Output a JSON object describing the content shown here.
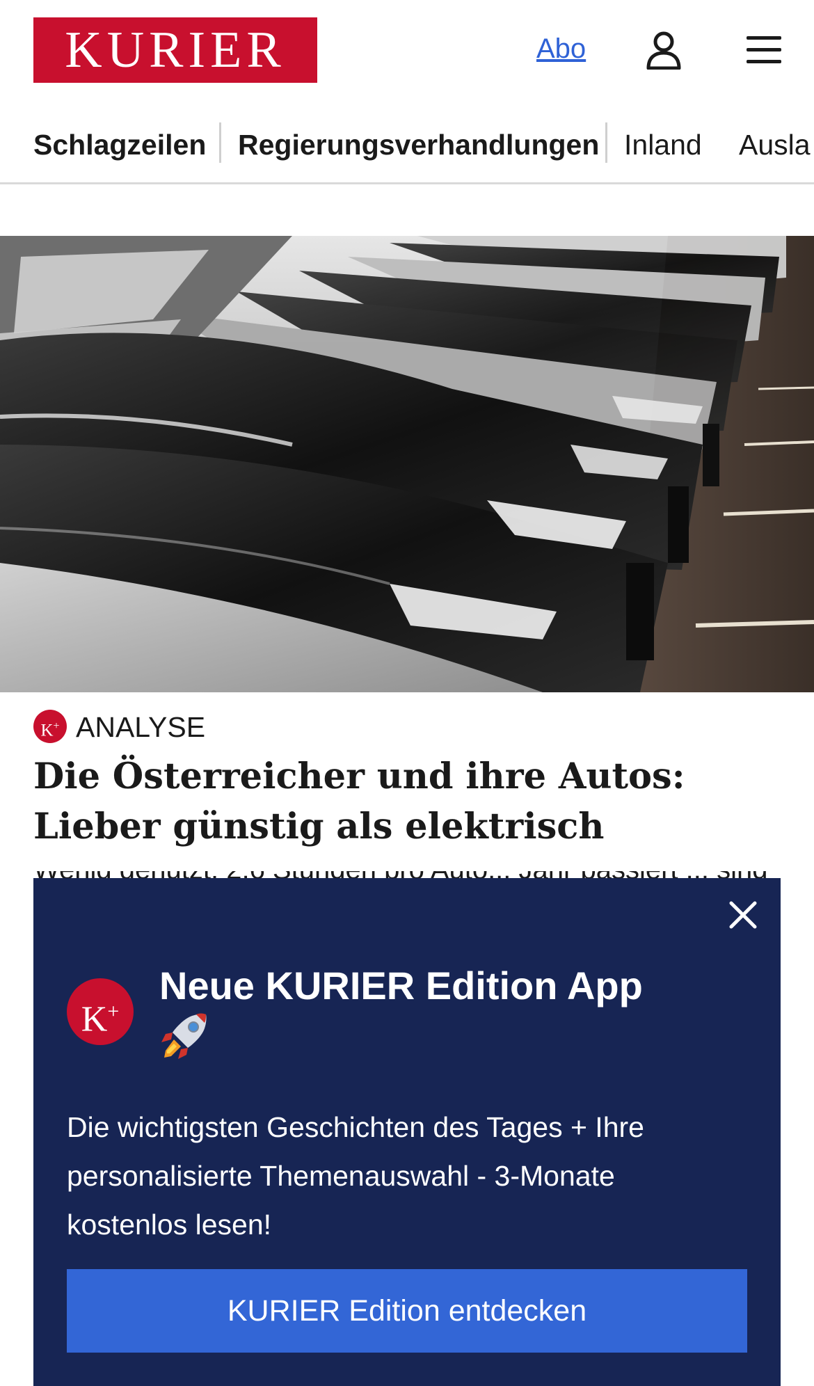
{
  "header": {
    "logo_text": "KURIER",
    "abo_label": "Abo",
    "user_icon": "user-icon",
    "menu_icon": "hamburger-menu-icon"
  },
  "nav": {
    "items": [
      {
        "label": "Schlagzeilen"
      },
      {
        "label": "Regierungsverhandlungen"
      },
      {
        "label": "Inland"
      },
      {
        "label": "Ausla"
      }
    ]
  },
  "article": {
    "badge_text": "K",
    "badge_sup": "+",
    "kicker": "ANALYSE",
    "headline": "Die Österreicher und ihre Autos: Lieber günstig als elektrisch",
    "lead_peek": "Wenig genutzt: 2,6 Stunden pro Auto... Jahr passiert ... sind"
  },
  "promo": {
    "badge_text": "K",
    "badge_sup": "+",
    "title": "Neue KURIER Edition App",
    "title_emoji_icon": "rocket-icon",
    "body": "Die wichtigsten Geschichten des Tages + Ihre personalisierte Themenauswahl - 3-Monate kostenlos lesen!",
    "cta_label": "KURIER Edition entdecken",
    "close_icon": "close-icon"
  },
  "colors": {
    "brand_red": "#c8102e",
    "link_blue": "#2f62d6",
    "promo_navy": "#172554",
    "cta_blue": "#3366d6"
  }
}
